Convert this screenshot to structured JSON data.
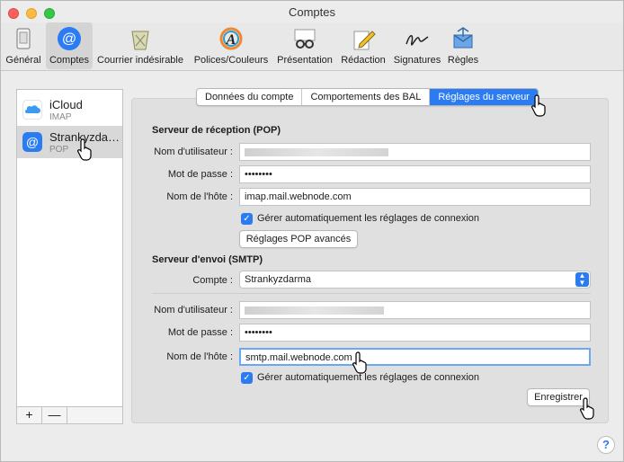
{
  "window": {
    "title": "Comptes"
  },
  "toolbar": {
    "items": [
      {
        "label": "Général",
        "icon": "general-icon"
      },
      {
        "label": "Comptes",
        "icon": "at-icon"
      },
      {
        "label": "Courrier indésirable",
        "icon": "junk-icon"
      },
      {
        "label": "Polices/Couleurs",
        "icon": "fonts-icon"
      },
      {
        "label": "Présentation",
        "icon": "glasses-icon"
      },
      {
        "label": "Rédaction",
        "icon": "pencil-icon"
      },
      {
        "label": "Signatures",
        "icon": "signature-icon"
      },
      {
        "label": "Règles",
        "icon": "rules-icon"
      }
    ],
    "selected": "Comptes"
  },
  "accounts": [
    {
      "name": "iCloud",
      "type": "IMAP",
      "icon": "icloud-icon"
    },
    {
      "name": "Strankyzda…",
      "type": "POP",
      "icon": "at-icon"
    }
  ],
  "sidebar_buttons": {
    "add": "+",
    "remove": "—"
  },
  "tabs": [
    "Données du compte",
    "Comportements des BAL",
    "Réglages du serveur"
  ],
  "selected_tab": "Réglages du serveur",
  "incoming": {
    "heading": "Serveur de réception (POP)",
    "username_label": "Nom d'utilisateur :",
    "password_label": "Mot de passe :",
    "password_value": "••••••••",
    "host_label": "Nom de l'hôte :",
    "host_value": "imap.mail.webnode.com",
    "auto_label": "Gérer automatiquement les réglages de connexion",
    "advanced_button": "Réglages POP avancés"
  },
  "outgoing": {
    "heading": "Serveur d'envoi (SMTP)",
    "account_label": "Compte :",
    "account_value": "Strankyzdarma",
    "username_label": "Nom d'utilisateur :",
    "password_label": "Mot de passe :",
    "password_value": "••••••••",
    "host_label": "Nom de l'hôte :",
    "host_value": "smtp.mail.webnode.com",
    "auto_label": "Gérer automatiquement les réglages de connexion"
  },
  "save_button": "Enregistrer",
  "help": "?",
  "colors": {
    "accent": "#2b7bf2",
    "close": "#fc605c",
    "minimize": "#fdbc40",
    "zoom": "#34c84a"
  }
}
